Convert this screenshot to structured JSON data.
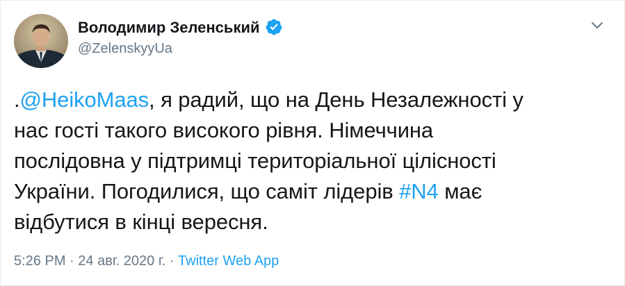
{
  "author": {
    "display_name": "Володимир Зеленський",
    "handle": "@ZelenskyyUa",
    "verified": true,
    "avatar_icon": "profile-photo"
  },
  "menu": {
    "icon": "chevron-down-icon"
  },
  "tweet": {
    "lines": [
      {
        "prefix": ".",
        "mention": "@HeikoMaas",
        "rest": ", я радий, що на День Незалежності у"
      },
      {
        "text": "нас гості такого високого рівня. Німеччина"
      },
      {
        "text": "послідовна у підтримці територіальної цілісності"
      },
      {
        "before": "України. Погодилися, що саміт лідерів ",
        "hashtag": "#N4",
        "after": " має"
      },
      {
        "text": "відбутися в кінці вересня."
      }
    ]
  },
  "meta": {
    "time": "5:26 PM",
    "separator1": " · ",
    "date": "24 авг. 2020 г.",
    "separator2": " · ",
    "source": "Twitter Web App"
  },
  "colors": {
    "link": "#1da1f2",
    "verified": "#1da1f2",
    "secondary_text": "#657786"
  }
}
